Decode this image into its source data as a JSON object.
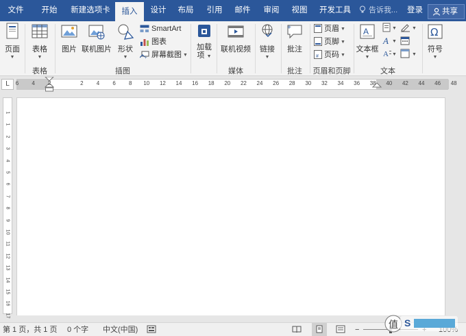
{
  "tabs": [
    "文件",
    "开始",
    "新建选项卡",
    "插入",
    "设计",
    "布局",
    "引用",
    "邮件",
    "审阅",
    "视图",
    "开发工具"
  ],
  "active_tab": "插入",
  "tell_me": "告诉我...",
  "login": "登录",
  "share": "共享",
  "ribbon": {
    "page_btn": "页面",
    "table_btn": "表格",
    "group_table": "表格",
    "picture_btn": "图片",
    "online_picture_btn": "联机图片",
    "shapes_btn": "形状",
    "smartart_btn": "SmartArt",
    "chart_btn": "图表",
    "screenshot_btn": "屏幕截图",
    "group_illustrations": "插图",
    "addins_btn_line1": "加载",
    "addins_btn_line2": "项",
    "online_video_btn": "联机视频",
    "group_media": "媒体",
    "link_btn": "链接",
    "comment_btn": "批注",
    "group_comments": "批注",
    "header_btn": "页眉",
    "footer_btn": "页脚",
    "page_number_btn": "页码",
    "group_header_footer": "页眉和页脚",
    "textbox_btn": "文本框",
    "group_text": "文本",
    "symbol_btn": "符号"
  },
  "ruler": {
    "corner": "L",
    "h_numbers": [
      "6",
      "4",
      "2",
      "",
      "2",
      "4",
      "6",
      "8",
      "10",
      "12",
      "14",
      "16",
      "18",
      "20",
      "22",
      "24",
      "26",
      "28",
      "30",
      "32",
      "34",
      "36",
      "38",
      "40",
      "42",
      "44",
      "46",
      "48"
    ],
    "v_numbers": [
      "1",
      "1",
      "2",
      "3",
      "4",
      "5",
      "6",
      "7",
      "8",
      "9",
      "10",
      "11",
      "12",
      "13",
      "14",
      "15",
      "16",
      "17"
    ]
  },
  "status": {
    "page": "第 1 页，共 1 页",
    "words": "0 个字",
    "language": "中文(中国)",
    "zoom_minus": "−",
    "zoom_plus": "+",
    "zoom": "100%"
  },
  "watermark": {
    "char": "值",
    "text": "S"
  },
  "colors": {
    "accent": "#2b579a",
    "ribbon_bg": "#f3f3f3"
  }
}
